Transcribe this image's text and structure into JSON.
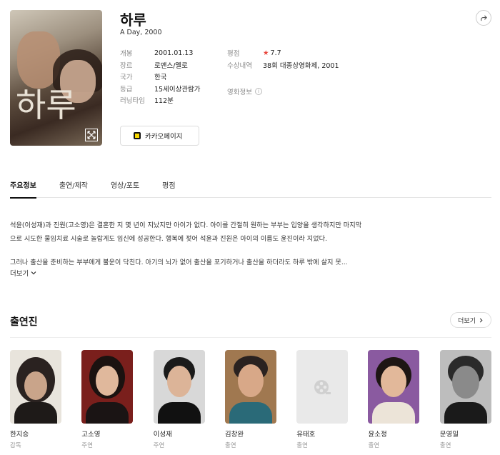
{
  "movie": {
    "title": "하루",
    "subtitle": "A Day, 2000",
    "poster_title": "하루"
  },
  "info_left": [
    {
      "label": "개봉",
      "value": "2001.01.13"
    },
    {
      "label": "장르",
      "value": "로맨스/멜로"
    },
    {
      "label": "국가",
      "value": "한국"
    },
    {
      "label": "등급",
      "value": "15세이상관람가"
    },
    {
      "label": "러닝타임",
      "value": "112분"
    }
  ],
  "info_right": {
    "rating_label": "평점",
    "rating_value": "7.7",
    "award_label": "수상내역",
    "award_value": "38회 대종상영화제, 2001",
    "movie_info_label": "영화정보"
  },
  "kakao_button": "카카오페이지",
  "tabs": [
    "주요정보",
    "출연/제작",
    "영상/포토",
    "평점"
  ],
  "synopsis": {
    "para1": "석윤(이성재)과 진원(고소영)은 결혼한 지 몇 년이 지났지만 아이가 없다. 아이를 간절히 원하는 부부는 입양을 생각하지만 마지막으로 시도한 물임치료 시술로 놀랍게도 임신에 성공한다. 행복에 젖어 석윤과 진원은 아이의 이름도 윤진이라 지었다.",
    "para2": "그러나 출산을 준비하는 부부에게 불운이 닥친다. 아기의 뇌가 없어 출산을 포기하거나 출산을 하더라도 하루 밖에 살지 못...",
    "more": "더보기"
  },
  "cast_section": {
    "title": "출연진",
    "more": "더보기"
  },
  "cast": [
    {
      "name": "한지승",
      "role": "감독",
      "photo": "person-photo"
    },
    {
      "name": "고소영",
      "role": "주연",
      "photo": "person-photo"
    },
    {
      "name": "이성재",
      "role": "주연",
      "photo": "person-photo"
    },
    {
      "name": "김창완",
      "role": "출연",
      "photo": "person-photo"
    },
    {
      "name": "유태호",
      "role": "출연",
      "photo": "film-placeholder-icon"
    },
    {
      "name": "윤소정",
      "role": "출연",
      "photo": "person-photo"
    },
    {
      "name": "문영일",
      "role": "출연",
      "photo": "person-photo"
    }
  ],
  "colors": {
    "star": "#e8453c",
    "link": "#3366cc",
    "kakao_yellow": "#f7d800"
  }
}
